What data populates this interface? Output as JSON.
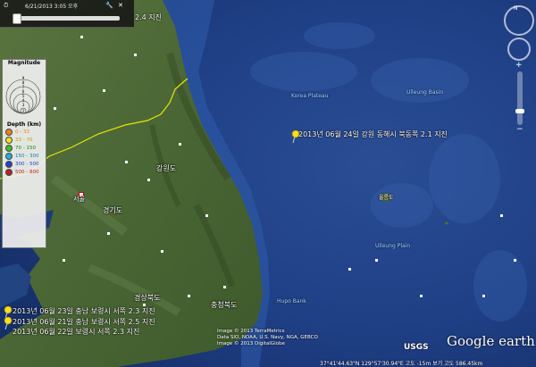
{
  "window": {
    "app_brand": "Google earth",
    "usgs_logo": "USGS"
  },
  "timeline": {
    "date": "6/21/2013  3:05 오후",
    "top_right_label": "2.4 지진",
    "icons": [
      "clock-icon",
      "settings-icon",
      "close-icon"
    ]
  },
  "legend": {
    "magnitude_title": "Magnitude",
    "magnitudes": [
      "2",
      "3",
      "4",
      "5",
      "6",
      "7",
      "8",
      "9"
    ],
    "depth_title": "Depth (km)",
    "depths": [
      {
        "label": "0 - 33",
        "color": "#f08020"
      },
      {
        "label": "33 - 70",
        "color": "#f0e020"
      },
      {
        "label": "70 - 150",
        "color": "#40c020"
      },
      {
        "label": "150 - 300",
        "color": "#20b0e0"
      },
      {
        "label": "300 - 500",
        "color": "#2040d0"
      },
      {
        "label": "500 - 800",
        "color": "#c02020"
      }
    ]
  },
  "placemarks": {
    "main": "2013년 06월 24일 강원 동해시 북동쪽 2.1 지진",
    "sw_1": "2013년 06월 23일 충남 보령시 서쪽 2.3 지진",
    "sw_2": "2013년 06월 21일 충남 보령시 서쪽 2.5 지진",
    "sw_3": "2013년 06월 22일 보령시 서쪽 2.3 지진"
  },
  "ocean_labels": {
    "korea_plateau": "Korea Plateau",
    "ulleung_basin": "Ulleung Basin",
    "ulleung_island": "울릉도",
    "ulleung_plain": "Ulleung Plain",
    "hupo_bank": "Hupo Bank"
  },
  "land_labels": {
    "gangwon": "강원도",
    "gyeonggi": "경기도",
    "seoul": "서울",
    "gyeongbuk": "경상북도",
    "chungbuk": "충청북도"
  },
  "credits": "Image © 2013 TerraMetrics\nData SIO, NOAA, U.S. Navy, NGA, GEBCO\nImage © 2013 DigitalGlobe",
  "status": "37°41'44.63\"N 129°57'30.94\"E 고도 -15m   보기 고도 586.45km",
  "colors": {
    "ocean": "#1c3d80",
    "land": "#4d6b35",
    "border": "#e6e600",
    "pin": "#f5e020"
  }
}
